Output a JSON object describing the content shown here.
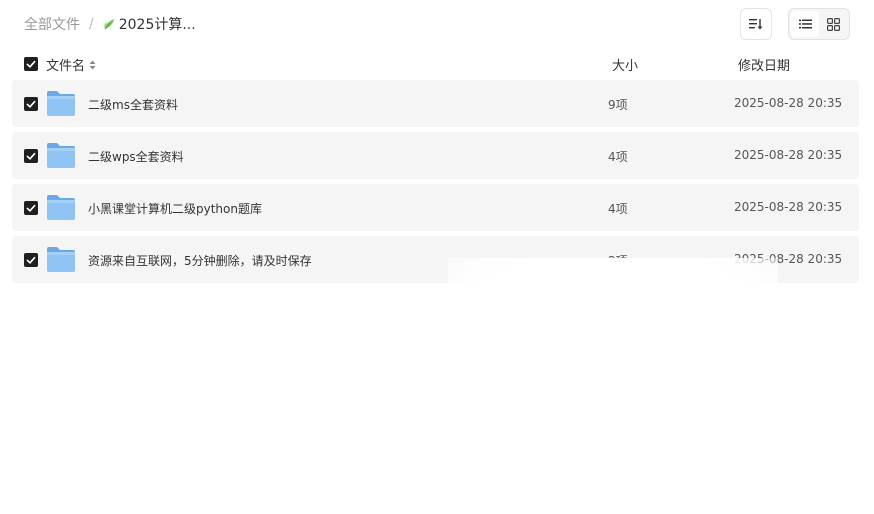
{
  "breadcrumb": {
    "root": "全部文件",
    "separator": "/",
    "current": "2025计算..."
  },
  "columns": {
    "name": "文件名",
    "size": "大小",
    "date": "修改日期"
  },
  "rows": [
    {
      "name": "二级ms全套资料",
      "size": "9项",
      "date": "2025-08-28 20:35",
      "checked": true
    },
    {
      "name": "二级wps全套资料",
      "size": "4项",
      "date": "2025-08-28 20:35",
      "checked": true
    },
    {
      "name": "小黑课堂计算机二级python题库",
      "size": "4项",
      "date": "2025-08-28 20:35",
      "checked": true
    },
    {
      "name": "资源来自互联网，5分钟删除，请及时保存",
      "size": "2项",
      "date": "2025-08-28 20:35",
      "checked": true
    }
  ],
  "icons": {
    "breadcrumb": "leaf-icon",
    "sort": "sort-icon",
    "list_view": "list-view-icon",
    "grid_view": "grid-view-icon",
    "folder": "folder-icon"
  },
  "colors": {
    "row_background": "#f5f5f6",
    "checkbox": "#1f1f1f",
    "folder": "#7db8f0",
    "leaf": "#7cc35a"
  }
}
